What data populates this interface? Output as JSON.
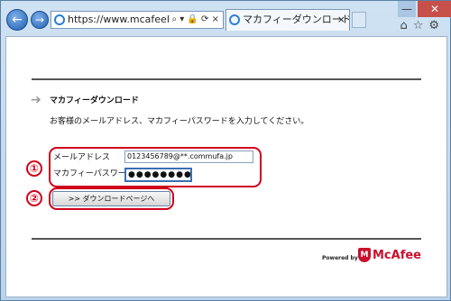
{
  "browser": {
    "address": "https://www.mcafeelogin.i...",
    "address_tools": "⌕ ▾ 🔒 × ↻ ×",
    "tab_title": "マカフィーダウンロード -...",
    "tab_close": "×",
    "back": "←",
    "forward": "→",
    "window_min": "—",
    "window_close": "✕",
    "tools": "⌂☆⚙"
  },
  "page": {
    "arrow": "➔",
    "heading": "マカフィーダウンロード",
    "intro": "お客様のメールアドレス、マカフィーパスワードを入力してください。",
    "step1": "①",
    "step2": "②",
    "email_label": "メールアドレス",
    "email_value": "0123456789@**.commufa.jp",
    "password_label": "マカフィーパスワード",
    "password_value": "●●●●●●●●",
    "download_button": ">> ダウンロードページへ",
    "powered_by": "Powered by",
    "logo_text": "McAfee",
    "logo_mark": "M"
  },
  "colors": {
    "highlight": "#d0001a",
    "brand": "#c8102e"
  }
}
